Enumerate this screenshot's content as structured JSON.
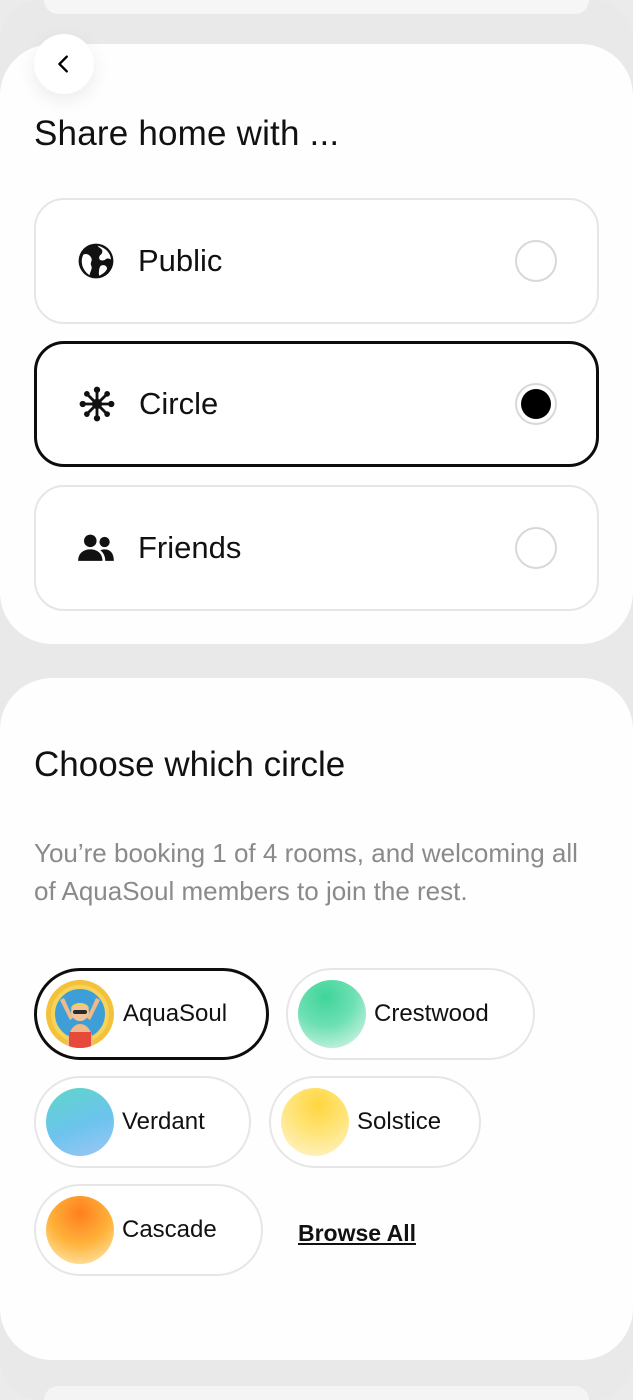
{
  "header": {
    "back_icon": "chevron-left-icon",
    "title": "Share home with ..."
  },
  "share_options": [
    {
      "label": "Public",
      "icon": "globe-icon",
      "selected": false
    },
    {
      "label": "Circle",
      "icon": "circle-network-icon",
      "selected": true
    },
    {
      "label": "Friends",
      "icon": "people-icon",
      "selected": false
    }
  ],
  "circle_section": {
    "title": "Choose which circle",
    "description": "You’re booking 1 of 4 rooms, and welcoming all of AquaSoul members to join the rest.",
    "circles": [
      {
        "label": "AquaSoul",
        "selected": true,
        "avatar": "photo-avatar"
      },
      {
        "label": "Crestwood",
        "selected": false,
        "colors": [
          "#3fd49a",
          "#e8f8f0"
        ]
      },
      {
        "label": "Verdant",
        "selected": false,
        "colors": [
          "#6ad9d6",
          "#5aa8f0"
        ]
      },
      {
        "label": "Solstice",
        "selected": false,
        "colors": [
          "#ffd63f",
          "#fff3c8"
        ]
      },
      {
        "label": "Cascade",
        "selected": false,
        "colors": [
          "#ff8c2a",
          "#fff0c0"
        ]
      }
    ],
    "browse_all_label": "Browse All"
  }
}
